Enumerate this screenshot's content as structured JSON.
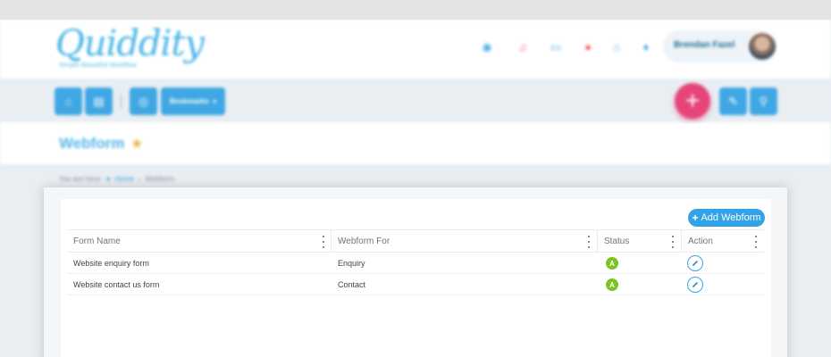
{
  "app": {
    "logo": {
      "name": "Quiddity",
      "tagline": "Simple·Beautiful·Workflow"
    },
    "header_icons": [
      {
        "name": "dashboard-icon",
        "glyph": "◉",
        "color": "#47aee6"
      },
      {
        "name": "users-icon",
        "glyph": "♫",
        "color": "#f06a8a"
      },
      {
        "name": "chat-icon",
        "glyph": "▭",
        "color": "#47aee6"
      },
      {
        "name": "message-icon",
        "glyph": "●",
        "color": "#f0655c"
      },
      {
        "name": "car-icon",
        "glyph": "⌂",
        "color": "#47aee6"
      },
      {
        "name": "microphone-icon",
        "glyph": "♦",
        "color": "#47aee6"
      }
    ],
    "user": {
      "name": "Brendan Fazel"
    },
    "toolbar": {
      "home_glyph": "⌂",
      "list_glyph": "▤",
      "globe_glyph": "◎",
      "bookmarks_label": "Bookmarks",
      "add_glyph": "+",
      "edit_glyph": "✎",
      "search_glyph": "⚲"
    },
    "page": {
      "title": "Webform",
      "star_glyph": "★",
      "breadcrumb": {
        "prefix": "You are here:",
        "home": "Home",
        "separator": "›",
        "current": "Webform"
      }
    },
    "accent_color": "#3fa7e3"
  },
  "webforms": {
    "add_button_label": "Add Webform",
    "add_button_glyph": "+",
    "columns": [
      "Form Name",
      "Webform For",
      "Status",
      "Action"
    ],
    "rows": [
      {
        "name": "Website enquiry form",
        "for": "Enquiry",
        "status": "A"
      },
      {
        "name": "Website contact us form",
        "for": "Contact",
        "status": "A"
      }
    ]
  }
}
